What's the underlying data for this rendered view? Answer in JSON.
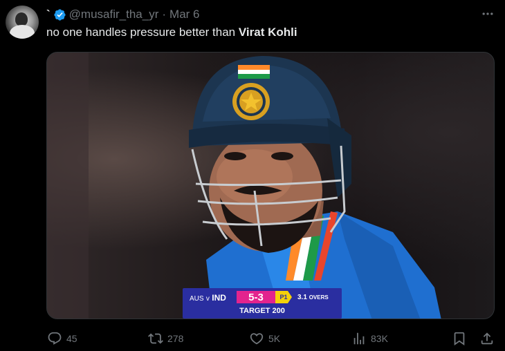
{
  "tweet": {
    "display_name": "`",
    "handle": "@musafir_tha_yr",
    "separator": "·",
    "date": "Mar 6",
    "text_plain": "no one handles pressure better than ",
    "text_bold": "Virat Kohli"
  },
  "media": {
    "scoreboard": {
      "teams_prefix": "AUS",
      "teams_v": "v",
      "teams_suffix": "IND",
      "score": "5-3",
      "powerplay": "P1",
      "overs_value": "3.1",
      "overs_label": "OVERS",
      "target": "TARGET 200"
    }
  },
  "actions": {
    "replies": "45",
    "retweets": "278",
    "likes": "5K",
    "views": "83K"
  },
  "colors": {
    "background": "#000000",
    "text": "#e7e9ea",
    "muted": "#71767b",
    "verified": "#1d9bf0",
    "score_pink": "#e3248e",
    "scoreboard_blue": "#2a2ea0"
  },
  "icons": [
    "verified-badge-icon",
    "more-icon",
    "reply-icon",
    "retweet-icon",
    "like-icon",
    "views-icon",
    "bookmark-icon",
    "share-icon"
  ]
}
